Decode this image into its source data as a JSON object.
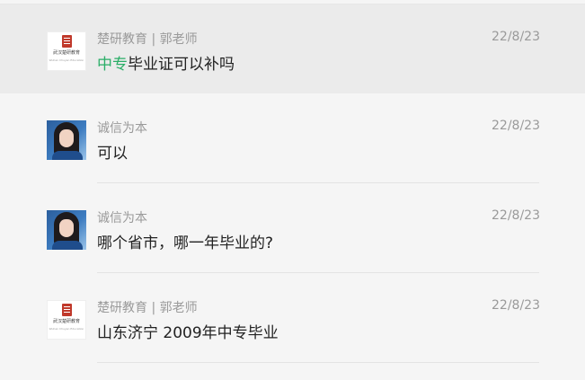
{
  "messages": [
    {
      "sender": "楚研教育 | 郭老师",
      "time": "22/8/23",
      "content_highlight": "中专",
      "content": "毕业证可以补吗",
      "avatar": "logo",
      "logo_text_cn": "武汉楚研教育",
      "logo_text_en": "Wuhan Chuyan Education"
    },
    {
      "sender": "诚信为本",
      "time": "22/8/23",
      "content_highlight": "",
      "content": "可以",
      "avatar": "photo"
    },
    {
      "sender": "诚信为本",
      "time": "22/8/23",
      "content_highlight": "",
      "content": "哪个省市，哪一年毕业的?",
      "avatar": "photo"
    },
    {
      "sender": "楚研教育 | 郭老师",
      "time": "22/8/23",
      "content_highlight": "",
      "content": "山东济宁 2009年中专毕业",
      "avatar": "logo",
      "logo_text_cn": "武汉楚研教育",
      "logo_text_en": "Wuhan Chuyan Education"
    }
  ],
  "colors": {
    "highlight": "#2aae67",
    "meta": "#9a9a9a",
    "text": "#222222",
    "selected_row": "#ebebeb"
  }
}
